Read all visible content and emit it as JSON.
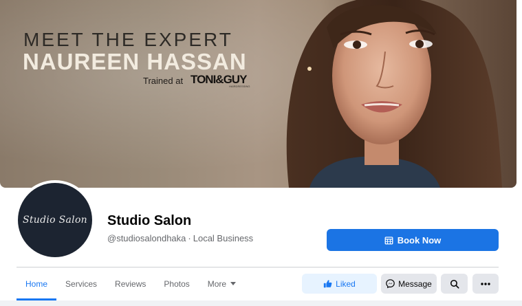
{
  "cover": {
    "headline": "MEET THE EXPERT",
    "expert_name": "NAUREEN HASSAN",
    "trained_label": "Trained at",
    "brand": "TONI&GUY",
    "brand_sub": "HAIRDRESSING"
  },
  "profile": {
    "logo_text": "Studio Salon",
    "name": "Studio Salon",
    "handle": "@studiosalondhaka",
    "separator": "·",
    "category": "Local Business"
  },
  "book_button": {
    "label": "Book Now",
    "icon": "calendar-icon"
  },
  "tabs": [
    {
      "label": "Home",
      "active": true
    },
    {
      "label": "Services",
      "active": false
    },
    {
      "label": "Reviews",
      "active": false
    },
    {
      "label": "Photos",
      "active": false
    },
    {
      "label": "More",
      "active": false,
      "icon": "caret-down-icon"
    }
  ],
  "actions": {
    "liked_label": "Liked",
    "message_label": "Message",
    "search_icon": "search-icon",
    "more_icon": "ellipsis-icon"
  },
  "colors": {
    "primary": "#1877f2",
    "book_button": "#1b74e4",
    "liked_bg": "#e7f3ff",
    "secondary_bg": "#e4e6eb",
    "avatar_bg": "#1c2431"
  }
}
